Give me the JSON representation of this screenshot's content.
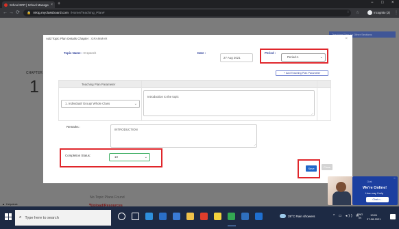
{
  "browser": {
    "tab_title": "School ERP | School Managemen",
    "url_host": "mktg.myclassboard.com",
    "url_path": "/Home/Teaching_Plan#",
    "incognito_label": "Incognito (2)",
    "new_tab_symbol": "+",
    "close_symbol": "×",
    "back_symbol": "←",
    "forward_symbol": "→",
    "reload_symbol": "⟳",
    "lock_symbol": "🔒",
    "star_symbol": "☆",
    "eye_off_symbol": "◌",
    "menu_symbol": "⋮",
    "minimize_symbol": "−",
    "maximize_symbol": "□"
  },
  "background_page": {
    "top_button": "Teaching Plan for Other Sections",
    "chapter_label": "CHAPTER",
    "chapter_number": "1",
    "no_topic": "No Topic Plans Found",
    "upload": "Upload/Resources",
    "help": "Helpdesk"
  },
  "modal": {
    "title_prefix": "Add Topic Plan Details Chapter : ",
    "chapter": "GRAMMAR",
    "close_symbol": "×",
    "topic_label": "Topic Name :",
    "topic_value": "O speech",
    "date_label": "Date :",
    "date_value": "27 Aug 2021",
    "period_label": "Period :",
    "period_value": "Period-1",
    "add_param_label": "+ Add Teaching Plan Parameter",
    "tpp_header": "Teaching Plan Parameter",
    "tpp_select_value": "1. Individual/ Group/ Whole Class",
    "tpp_text": "Introduction to the topic",
    "remarks_label": "Remarks :",
    "remarks_value": "INTRODUCTION",
    "completion_label": "Completion Status:",
    "completion_value": "10",
    "save_label": "Save",
    "close_label": "Close"
  },
  "chat": {
    "minimize": "−",
    "mini_text": "Chat",
    "title": "We're Online!",
    "subtitle": "How may I help",
    "button": "Chat n..."
  },
  "taskbar": {
    "search_placeholder": "Type here to search",
    "weather": "28°C  Rain showers",
    "tray_symbols": "^ ▭ ◂)) ✉",
    "lang_line1": "ENG",
    "lang_line2": "IN",
    "time": "13:01",
    "date": "27-08-2021",
    "icons": [
      {
        "name": "cortana-icon",
        "color": "#ffffff"
      },
      {
        "name": "task-view-icon",
        "color": "#ffffff"
      },
      {
        "name": "edge-icon",
        "color": "#2e8fdc"
      },
      {
        "name": "mail-icon",
        "color": "#2a6fc7"
      },
      {
        "name": "store-icon",
        "color": "#3a7bd5"
      },
      {
        "name": "explorer-icon",
        "color": "#f0c24a"
      },
      {
        "name": "office-icon",
        "color": "#e03d2b"
      },
      {
        "name": "sticky-notes-icon",
        "color": "#f3d23d"
      },
      {
        "name": "chrome-icon",
        "color": "#33a852"
      },
      {
        "name": "photos-icon",
        "color": "#2f6fbd"
      },
      {
        "name": "outlook-icon",
        "color": "#1f6fd0"
      }
    ]
  },
  "colors": {
    "highlight_red": "#e0262b",
    "brand_blue": "#2d3e99",
    "save_blue": "#1f66c9"
  }
}
